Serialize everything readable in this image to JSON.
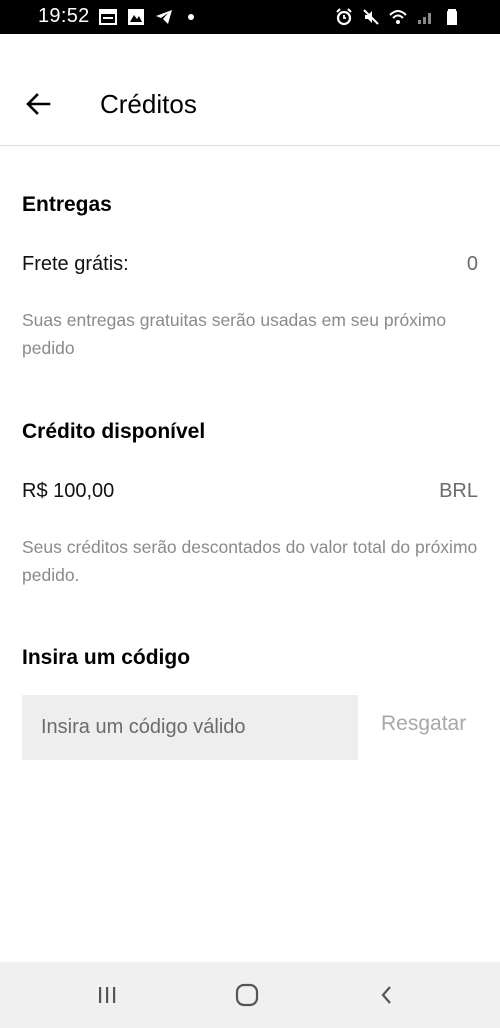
{
  "status_bar": {
    "time": "19:52",
    "left_icons": [
      "calendar-icon",
      "gallery-icon",
      "telegram-icon",
      "notification-dot-icon"
    ],
    "right_icons": [
      "alarm-icon",
      "mute-icon",
      "wifi-icon",
      "signal-icon",
      "battery-icon"
    ]
  },
  "header": {
    "title": "Créditos",
    "back_icon": "arrow-left-icon"
  },
  "deliveries": {
    "title": "Entregas",
    "free_shipping_label": "Frete grátis:",
    "free_shipping_value": "0",
    "hint": "Suas entregas gratuitas serão usadas em seu próximo pedido"
  },
  "credit": {
    "title": "Crédito disponível",
    "amount": "R$ 100,00",
    "currency": "BRL",
    "hint": "Seus créditos serão descontados do valor total do próximo pedido."
  },
  "promo": {
    "title": "Insira um código",
    "input_placeholder": "Insira um código válido",
    "input_value": "",
    "redeem_label": "Resgatar"
  },
  "nav_bar": {
    "icons": [
      "recent-apps-icon",
      "home-icon",
      "back-icon"
    ]
  },
  "colors": {
    "status_bar_bg": "#000000",
    "input_bg": "#eeeeee",
    "hint_text": "#8a8a8a",
    "disabled_action": "#a8a8a8",
    "nav_bar_bg": "#f0f0f0"
  }
}
